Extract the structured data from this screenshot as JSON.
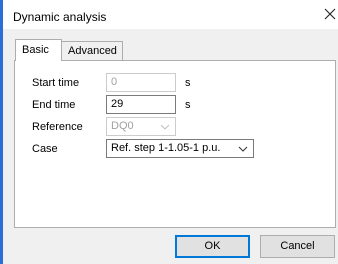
{
  "dialog": {
    "title": "Dynamic analysis",
    "close_icon": "close-icon"
  },
  "tabs": [
    {
      "label": "Basic",
      "active": true
    },
    {
      "label": "Advanced",
      "active": false
    }
  ],
  "form": {
    "start_time": {
      "label": "Start time",
      "value": "0",
      "unit": "s",
      "enabled": false
    },
    "end_time": {
      "label": "End time",
      "value": "29",
      "unit": "s",
      "enabled": true
    },
    "reference": {
      "label": "Reference",
      "value": "DQ0",
      "enabled": false
    },
    "case": {
      "label": "Case",
      "value": "Ref. step 1-1.05-1 p.u.",
      "enabled": true
    }
  },
  "buttons": {
    "ok_label": "OK",
    "cancel_label": "Cancel"
  },
  "colors": {
    "accent": "#0078d7",
    "window_border": "#2b6fd6"
  }
}
